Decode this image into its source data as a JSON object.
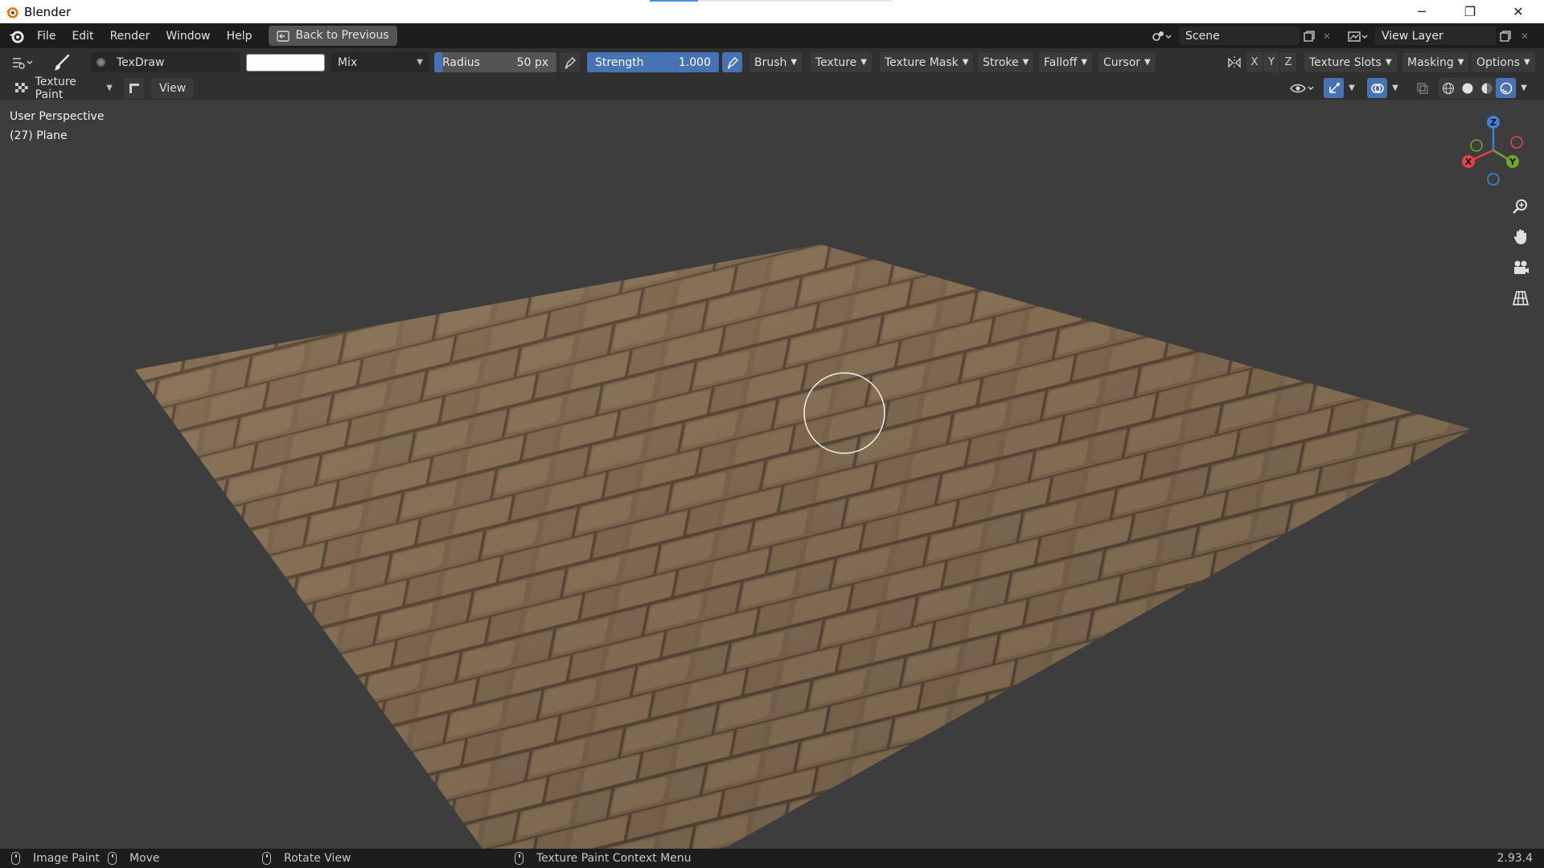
{
  "window": {
    "title": "Blender",
    "minimize_glyph": "─",
    "maximize_glyph": "❐",
    "close_glyph": "✕"
  },
  "menu": {
    "items": [
      "File",
      "Edit",
      "Render",
      "Window",
      "Help"
    ],
    "back_to_previous": "Back to Previous"
  },
  "header": {
    "scene_value": "Scene",
    "view_layer_value": "View Layer"
  },
  "tool_header": {
    "brush_name": "TexDraw",
    "blend_mode": "Mix",
    "radius_label": "Radius",
    "radius_value": "50 px",
    "strength_label": "Strength",
    "strength_value": "1.000",
    "strength_fraction": 1.0,
    "color_swatch": "#ffffff",
    "menus": [
      "Brush",
      "Texture",
      "Texture Mask",
      "Stroke",
      "Falloff",
      "Cursor"
    ],
    "axis_buttons": [
      "X",
      "Y",
      "Z"
    ],
    "right_menus": [
      "Texture Slots",
      "Masking",
      "Options"
    ]
  },
  "mode_header": {
    "mode": "Texture Paint",
    "view_label": "View"
  },
  "viewport": {
    "perspective": "User Perspective",
    "object_info": "(27) Plane",
    "gizmo_axes": [
      "Z",
      "Y",
      "X"
    ],
    "colors": {
      "background": "#3d3d3d",
      "axis_x": "#e8404f",
      "axis_y": "#6fa723",
      "axis_z": "#3f82d8",
      "accent_blue": "#4772b3"
    },
    "nav_icons": [
      "zoom-icon",
      "hand-pan-icon",
      "camera-icon",
      "grid-ortho-icon"
    ]
  },
  "status_bar": {
    "items": [
      "Image Paint",
      "Move",
      "Rotate View",
      "Texture Paint Context Menu"
    ],
    "version": "2.93.4"
  }
}
